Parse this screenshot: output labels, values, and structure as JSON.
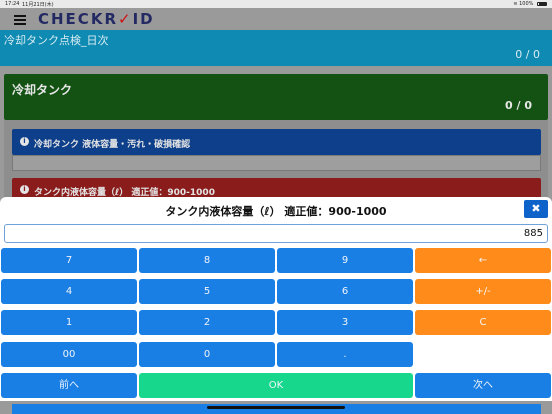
{
  "status_bar": {
    "time": "17:24",
    "date": "11月21日(木)",
    "battery": "100%"
  },
  "app": {
    "logo_prefix": "CHECKR",
    "logo_mark": "✓",
    "logo_suffix": "ID"
  },
  "page": {
    "title": "冷却タンク点検_日次",
    "count": "0 / 0"
  },
  "section": {
    "name": "冷却タンク",
    "count": "0 / 0",
    "items": [
      {
        "label": "冷却タンク 液体容量・汚れ・破損確認",
        "color": "#0d3f8a"
      },
      {
        "label": "タンク内液体容量（ℓ） 適正値：900-1000",
        "color": "#8a1c1c"
      }
    ]
  },
  "dialog": {
    "title": "タンク内液体容量（ℓ） 適正値：900-1000",
    "close_label": "✖",
    "value": "885",
    "keys": {
      "k7": "7",
      "k8": "8",
      "k9": "9",
      "back": "←",
      "k4": "4",
      "k5": "5",
      "k6": "6",
      "plusminus": "+/-",
      "k1": "1",
      "k2": "2",
      "k3": "3",
      "clear": "C",
      "k00": "00",
      "k0": "0",
      "dot": "."
    },
    "prev_label": "前へ",
    "ok_label": "OK",
    "next_label": "次へ"
  },
  "colors": {
    "key_blue": "#1a7fe5",
    "key_orange": "#ff8c1a",
    "ok_green": "#16d78c",
    "title_bar": "#0f8ab2",
    "section_green": "#145214"
  }
}
